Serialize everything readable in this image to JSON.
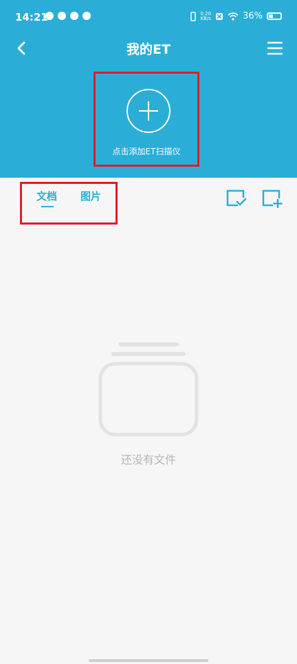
{
  "status_bar": {
    "time": "14:21",
    "speed_top": "0.20",
    "speed_unit": "KB/s",
    "battery": "36%"
  },
  "header": {
    "title": "我的ET"
  },
  "add_scanner": {
    "label": "点击添加ET扫描仪"
  },
  "tabs": [
    {
      "label": "文档",
      "active": true
    },
    {
      "label": "图片",
      "active": false
    }
  ],
  "empty_state": {
    "text": "还没有文件"
  },
  "colors": {
    "primary": "#2aaed8",
    "highlight_box": "#e01b2a",
    "background": "#f6f6f6",
    "muted_text": "#b5b5b5"
  },
  "icons": {
    "back": "chevron-left-icon",
    "menu": "hamburger-menu-icon",
    "add": "plus-circle-icon",
    "select": "check-box-icon",
    "new": "plus-box-icon",
    "empty": "empty-folder-icon"
  }
}
